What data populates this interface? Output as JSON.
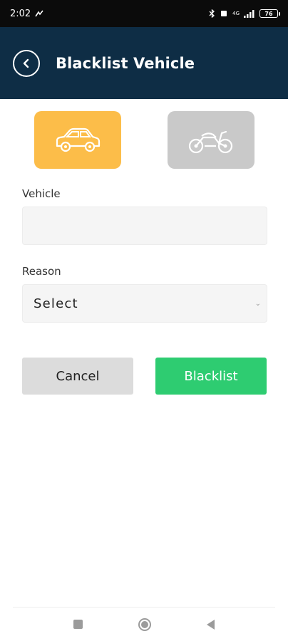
{
  "status_bar": {
    "time": "2:02",
    "network_label": "4G",
    "battery_level": "76"
  },
  "header": {
    "title": "Blacklist Vehicle",
    "background_color": "#0e2d45"
  },
  "vehicle_types": [
    {
      "name": "car",
      "selected": true,
      "color": "#fcbd49",
      "icon": "car-icon"
    },
    {
      "name": "motorcycle",
      "selected": false,
      "color": "#c9c9c9",
      "icon": "motorcycle-icon"
    }
  ],
  "form": {
    "vehicle_label": "Vehicle",
    "vehicle_value": "",
    "reason_label": "Reason",
    "reason_selected": "Select"
  },
  "actions": {
    "cancel_label": "Cancel",
    "blacklist_label": "Blacklist",
    "blacklist_color": "#2ecc71"
  },
  "nav_bar": [
    "recents-square-icon",
    "home-circle-icon",
    "back-triangle-icon"
  ]
}
